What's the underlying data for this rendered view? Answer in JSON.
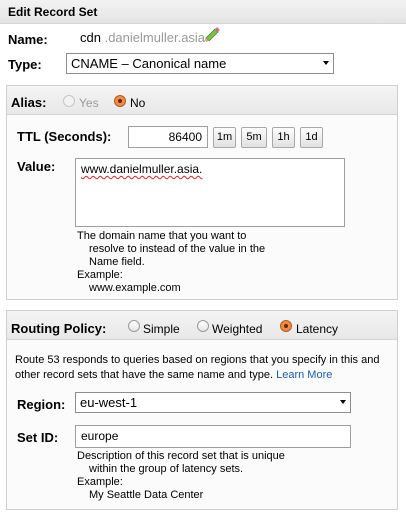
{
  "header": {
    "title": "Edit Record Set"
  },
  "name": {
    "label": "Name:",
    "prefix": "cdn",
    "suffix": ".danielmuller.asia.",
    "edit_icon": "pencil-icon"
  },
  "type": {
    "label": "Type:",
    "selected": "CNAME – Canonical name"
  },
  "alias": {
    "label": "Alias:",
    "options": [
      {
        "label": "Yes",
        "checked": false,
        "disabled": true
      },
      {
        "label": "No",
        "checked": true,
        "disabled": false
      }
    ]
  },
  "ttl": {
    "label": "TTL (Seconds):",
    "value": "86400",
    "buttons": [
      "1m",
      "5m",
      "1h",
      "1d"
    ]
  },
  "value": {
    "label": "Value:",
    "text": "www.danielmuller.asia.",
    "help": [
      "The domain name that you want to",
      "resolve to instead of the value in the",
      "Name field."
    ],
    "example_label": "Example:",
    "example": "www.example.com"
  },
  "routing": {
    "label": "Routing Policy:",
    "options": [
      {
        "label": "Simple",
        "checked": false
      },
      {
        "label": "Weighted",
        "checked": false
      },
      {
        "label": "Latency",
        "checked": true
      }
    ],
    "description_1": "Route 53 responds to queries based on regions that you specify in this and",
    "description_2": "other record sets that have the same name and type.",
    "learn_more": "Learn More"
  },
  "region": {
    "label": "Region:",
    "selected": "eu-west-1"
  },
  "set_id": {
    "label": "Set ID:",
    "value": "europe",
    "help": [
      "Description of this record set that is unique",
      "within the group of latency sets."
    ],
    "example_label": "Example:",
    "example": "My Seattle Data Center"
  },
  "colors": {
    "accent_radio": "#f08a46",
    "link": "#1a5ea8"
  }
}
